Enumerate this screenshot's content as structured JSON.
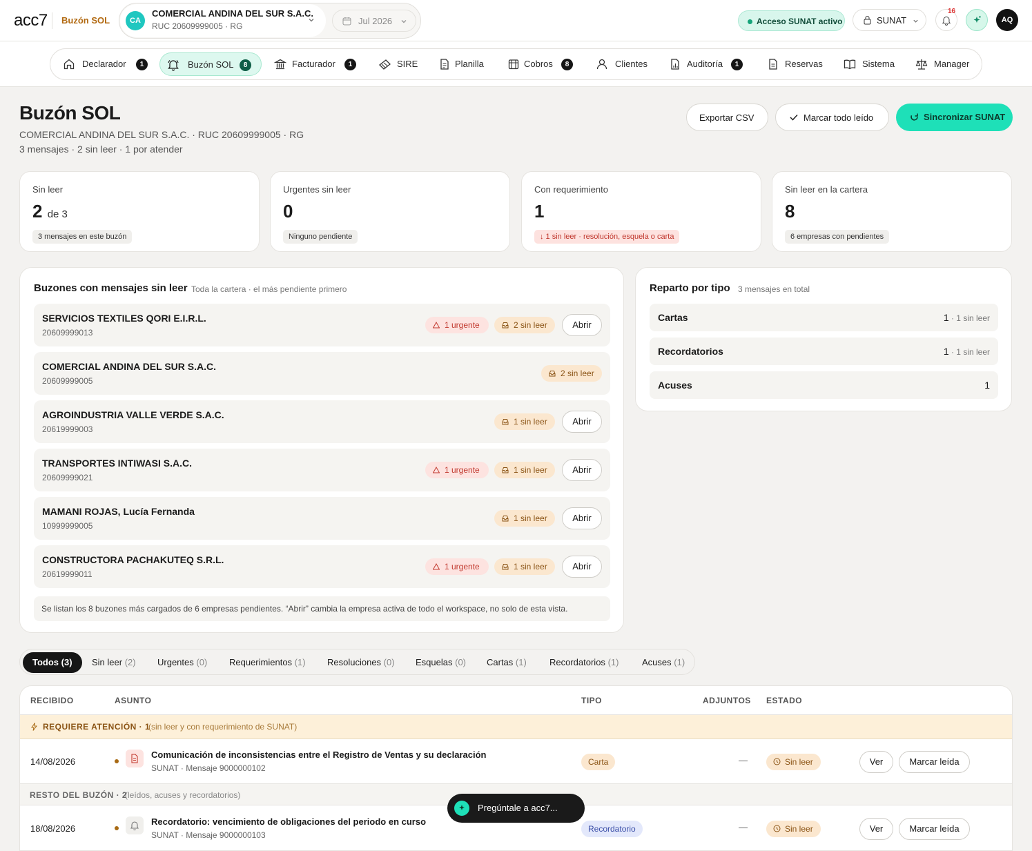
{
  "app": {
    "logo": "acc7",
    "section": "Buzón SOL"
  },
  "company_selector": {
    "initials": "CA",
    "name": "COMERCIAL ANDINA DEL SUR S.A.C.",
    "sub": "RUC 20609999005 · RG"
  },
  "period": {
    "label": "Jul 2026"
  },
  "topbar": {
    "access_label": "Acceso SUNAT activo",
    "sunat_label": "SUNAT",
    "notifications_count": "16",
    "user_initials": "AQ"
  },
  "nav": [
    {
      "label": "Declarador",
      "badge": "1"
    },
    {
      "label": "Buzón SOL",
      "badge": "8"
    },
    {
      "label": "Facturador",
      "badge": "1"
    },
    {
      "label": "SIRE",
      "badge": ""
    },
    {
      "label": "Planilla",
      "badge": ""
    },
    {
      "label": "Cobros",
      "badge": "8"
    },
    {
      "label": "Clientes",
      "badge": ""
    },
    {
      "label": "Auditoría",
      "badge": "1"
    },
    {
      "label": "Reservas",
      "badge": ""
    },
    {
      "label": "Sistema",
      "badge": ""
    },
    {
      "label": "Manager",
      "badge": ""
    }
  ],
  "page": {
    "title": "Buzón SOL",
    "subtitle": "COMERCIAL ANDINA DEL SUR S.A.C. · RUC 20609999005 · RG",
    "summary": "3 mensajes · 2 sin leer · 1 por atender",
    "export_label": "Exportar CSV",
    "mark_all_label": "Marcar todo leído",
    "sync_label": "Sincronizar SUNAT"
  },
  "kpis": [
    {
      "label": "Sin leer",
      "value": "2",
      "suffix": "de 3",
      "chip": "3 mensajes en este buzón"
    },
    {
      "label": "Urgentes sin leer",
      "value": "0",
      "suffix": "",
      "chip": "Ninguno pendiente"
    },
    {
      "label": "Con requerimiento",
      "value": "1",
      "suffix": "",
      "chip": "↓ 1 sin leer · resolución, esquela o carta"
    },
    {
      "label": "Sin leer en la cartera",
      "value": "8",
      "suffix": "",
      "chip": "6 empresas con pendientes"
    }
  ],
  "mailboxes": {
    "title": "Buzones con mensajes sin leer",
    "note": "Toda la cartera · el más pendiente primero",
    "open_label": "Abrir",
    "items": [
      {
        "name": "SERVICIOS TEXTILES QORI E.I.R.L.",
        "ruc": "20609999013",
        "urgent": "1 urgente",
        "unread": "2 sin leer"
      },
      {
        "name": "COMERCIAL ANDINA DEL SUR S.A.C.",
        "ruc": "20609999005",
        "urgent": "",
        "unread": "2 sin leer"
      },
      {
        "name": "AGROINDUSTRIA VALLE VERDE S.A.C.",
        "ruc": "20619999003",
        "urgent": "",
        "unread": "1 sin leer"
      },
      {
        "name": "TRANSPORTES INTIWASI S.A.C.",
        "ruc": "20609999021",
        "urgent": "1 urgente",
        "unread": "1 sin leer"
      },
      {
        "name": "MAMANI ROJAS, Lucía Fernanda",
        "ruc": "10999999005",
        "urgent": "",
        "unread": "1 sin leer"
      },
      {
        "name": "CONSTRUCTORA PACHAKUTEQ S.R.L.",
        "ruc": "20619999011",
        "urgent": "1 urgente",
        "unread": "1 sin leer"
      }
    ],
    "footer": "Se listan los 8 buzones más cargados de 6 empresas pendientes. “Abrir” cambia la empresa activa de todo el workspace, no solo de esta vista."
  },
  "types": {
    "title": "Reparto por tipo",
    "note": "3 mensajes en total",
    "items": [
      {
        "name": "Cartas",
        "count": "1",
        "unread": " · 1 sin leer"
      },
      {
        "name": "Recordatorios",
        "count": "1",
        "unread": " · 1 sin leer"
      },
      {
        "name": "Acuses",
        "count": "1",
        "unread": ""
      }
    ]
  },
  "filters": [
    {
      "label": "Todos",
      "count": "(3)"
    },
    {
      "label": "Sin leer",
      "count": "(2)"
    },
    {
      "label": "Urgentes",
      "count": "(0)"
    },
    {
      "label": "Requerimientos",
      "count": "(1)"
    },
    {
      "label": "Resoluciones",
      "count": "(0)"
    },
    {
      "label": "Esquelas",
      "count": "(0)"
    },
    {
      "label": "Cartas",
      "count": "(1)"
    },
    {
      "label": "Recordatorios",
      "count": "(1)"
    },
    {
      "label": "Acuses",
      "count": "(1)"
    }
  ],
  "table": {
    "headers": [
      "RECIBIDO",
      "ASUNTO",
      "TIPO",
      "ADJUNTOS",
      "ESTADO"
    ],
    "group_attention": {
      "title": "REQUIERE ATENCIÓN · 1",
      "note": "(sin leer y con requerimiento de SUNAT)"
    },
    "group_rest": {
      "title": "RESTO DEL BUZÓN · 2",
      "note": "(leídos, acuses y recordatorios)"
    },
    "view_label": "Ver",
    "mark_read_label": "Marcar leída",
    "rows": [
      {
        "date": "14/08/2026",
        "subject": "Comunicación de inconsistencias entre el Registro de Ventas y su declaración",
        "meta": "SUNAT · Mensaje 9000000102",
        "type": "Carta",
        "attachments": "—",
        "status": "Sin leer"
      },
      {
        "date": "18/08/2026",
        "subject": "Recordatorio: vencimiento de obligaciones del periodo en curso",
        "meta": "SUNAT · Mensaje 9000000103",
        "type": "Recordatorio",
        "attachments": "—",
        "status": "Sin leer"
      }
    ]
  },
  "assistant": {
    "label": "Pregúntale a acc7..."
  }
}
